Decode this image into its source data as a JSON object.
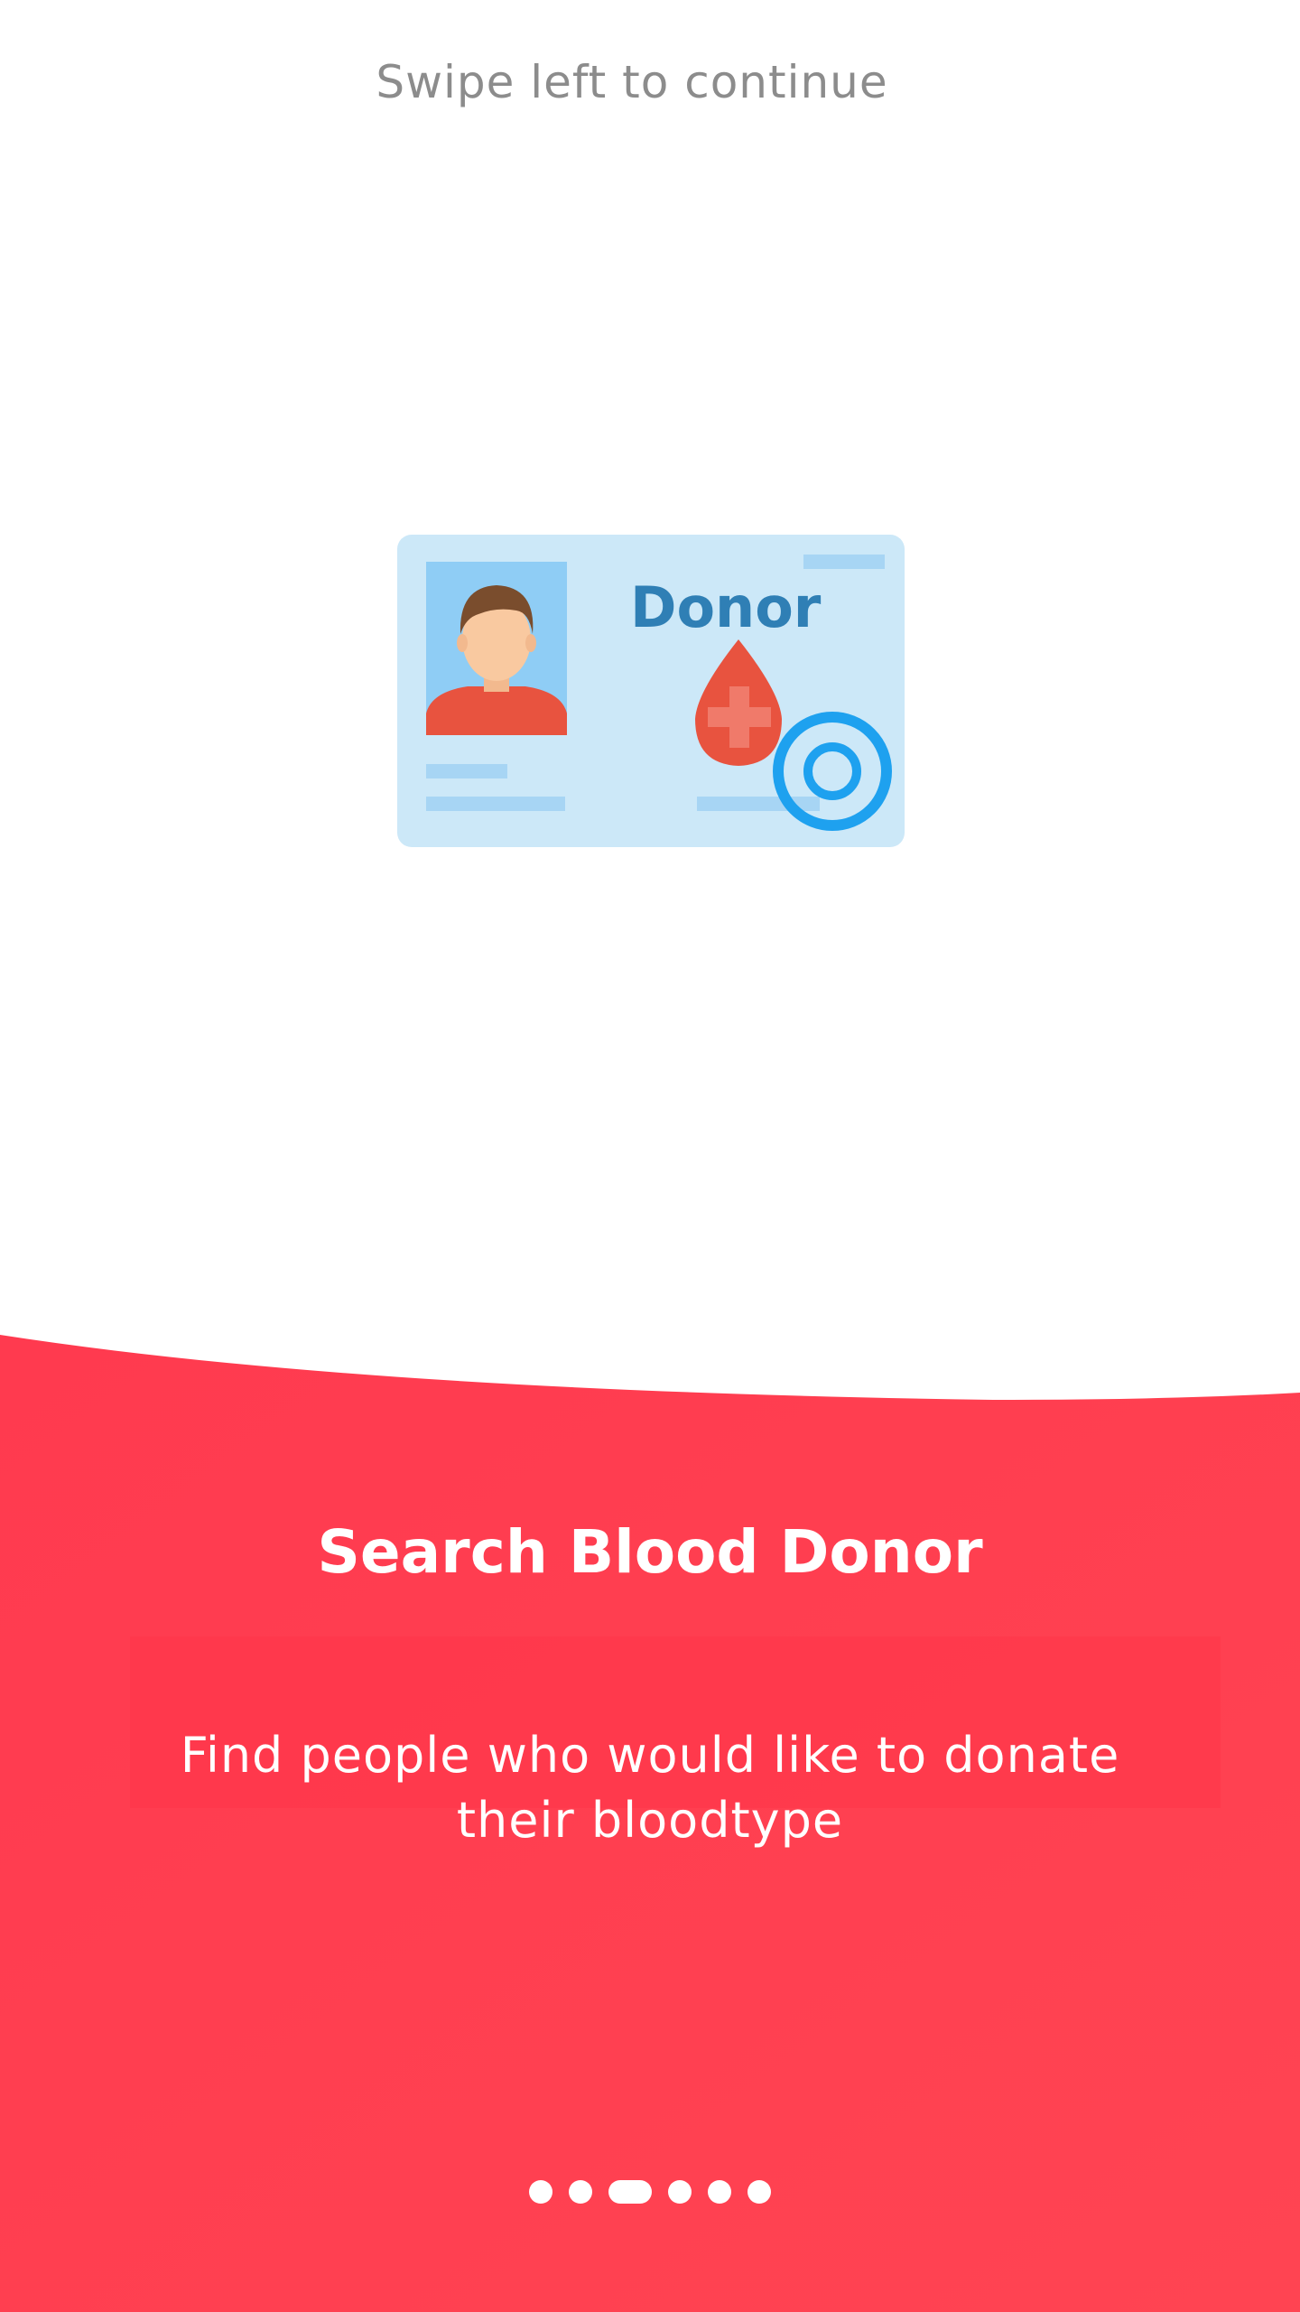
{
  "hint": {
    "text": "Swipe left to continue"
  },
  "illustration": {
    "icon": "donor-card-icon",
    "card_label": "Donor",
    "card_color": "#cce8f8",
    "label_color": "#2f7fb5",
    "drop_color": "#e8533f",
    "badge_color": "#1ea1ef"
  },
  "slide": {
    "title": "Search Blood Donor",
    "description_line1": "Find people who would like to donate",
    "description_line2": "their bloodtype",
    "background_color": "#ff3a4f"
  },
  "pager": {
    "count": 6,
    "active_index": 2
  }
}
